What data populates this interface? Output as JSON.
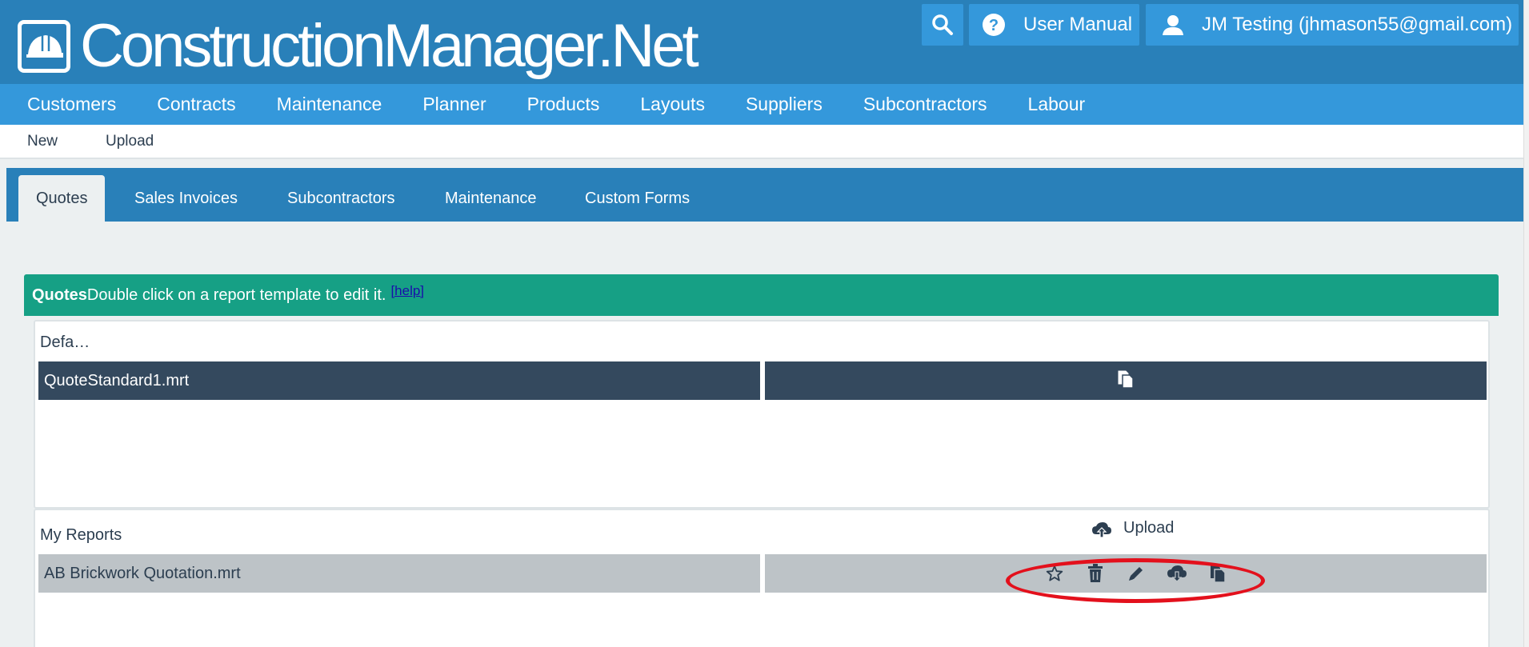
{
  "app": {
    "logo_text": "ConstructionManager.Net"
  },
  "header": {
    "search_icon": "search-icon",
    "user_manual_label": "User Manual",
    "user_label": "JM Testing (jhmason55@gmail.com)"
  },
  "main_nav": [
    {
      "label": "Customers"
    },
    {
      "label": "Contracts"
    },
    {
      "label": "Maintenance"
    },
    {
      "label": "Planner"
    },
    {
      "label": "Products"
    },
    {
      "label": "Layouts"
    },
    {
      "label": "Suppliers"
    },
    {
      "label": "Subcontractors"
    },
    {
      "label": "Labour"
    }
  ],
  "sub_nav": [
    {
      "label": "New"
    },
    {
      "label": "Upload"
    }
  ],
  "tabs": [
    {
      "label": "Quotes",
      "active": true
    },
    {
      "label": "Sales Invoices"
    },
    {
      "label": "Subcontractors"
    },
    {
      "label": "Maintenance"
    },
    {
      "label": "Custom Forms"
    }
  ],
  "panel": {
    "title": "Quotes",
    "instruction": "Double click on a report template to edit it.",
    "help_label": "[help]"
  },
  "default_section": {
    "label": "Defa…",
    "rows": [
      {
        "name": "QuoteStandard1.mrt",
        "actions": [
          "copy-icon"
        ]
      }
    ]
  },
  "my_reports_section": {
    "label": "My Reports",
    "upload_label": "Upload",
    "rows": [
      {
        "name": "AB Brickwork Quotation.mrt",
        "actions": [
          "star-icon",
          "trash-icon",
          "pencil-icon",
          "cloud-download-icon",
          "copy-icon"
        ]
      }
    ]
  },
  "colors": {
    "header_bg": "#2980b9",
    "nav_bg": "#3498db",
    "panel_head_bg": "#16a085",
    "dark_row": "#34495e",
    "grey_row": "#bdc3c7",
    "highlight": "#e3101c"
  }
}
